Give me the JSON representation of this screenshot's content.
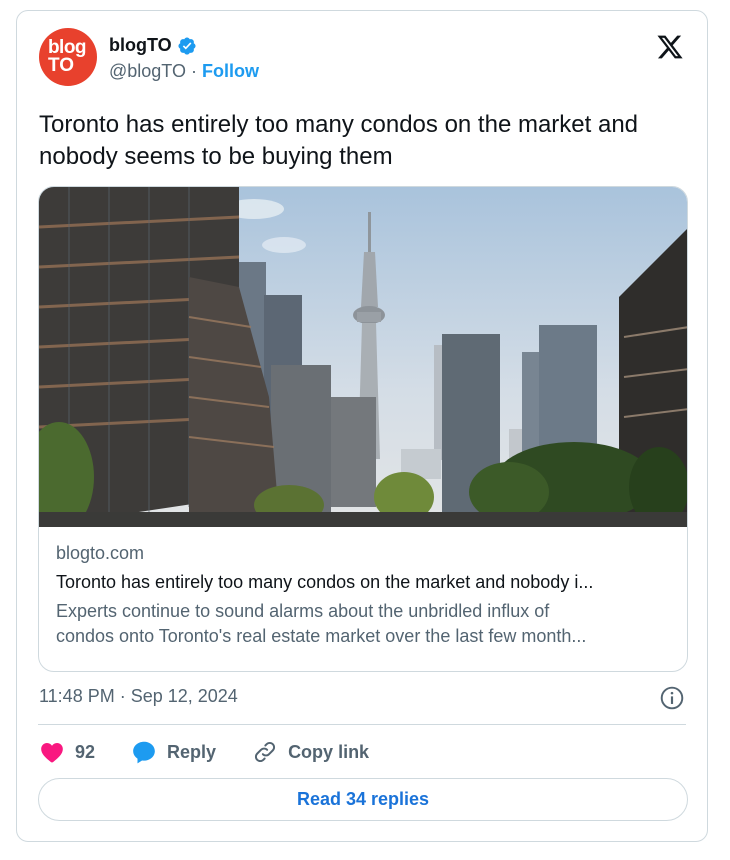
{
  "author": {
    "avatar_line1": "blog",
    "avatar_line2": "TO",
    "name": "blogTO",
    "handle": "@blogTO",
    "separator": " · ",
    "follow_label": "Follow"
  },
  "tweet": {
    "text": "Toronto has entirely too many condos on the market and nobody seems to be buying them"
  },
  "link_card": {
    "domain": "blogto.com",
    "title": "Toronto has entirely too many condos on the market and nobody i...",
    "description_line1": "Experts continue to sound alarms about the unbridled influx of",
    "description_line2": "condos onto Toronto's real estate market over the last few month..."
  },
  "meta": {
    "timestamp": "11:48 PM · Sep 12, 2024"
  },
  "actions": {
    "like_count": "92",
    "reply_label": "Reply",
    "copy_link_label": "Copy link"
  },
  "read_replies_label": "Read 34 replies",
  "colors": {
    "accent": "#1d9bf0",
    "like": "#f91880",
    "avatar_bg": "#e8412d",
    "text_secondary": "#536471"
  }
}
